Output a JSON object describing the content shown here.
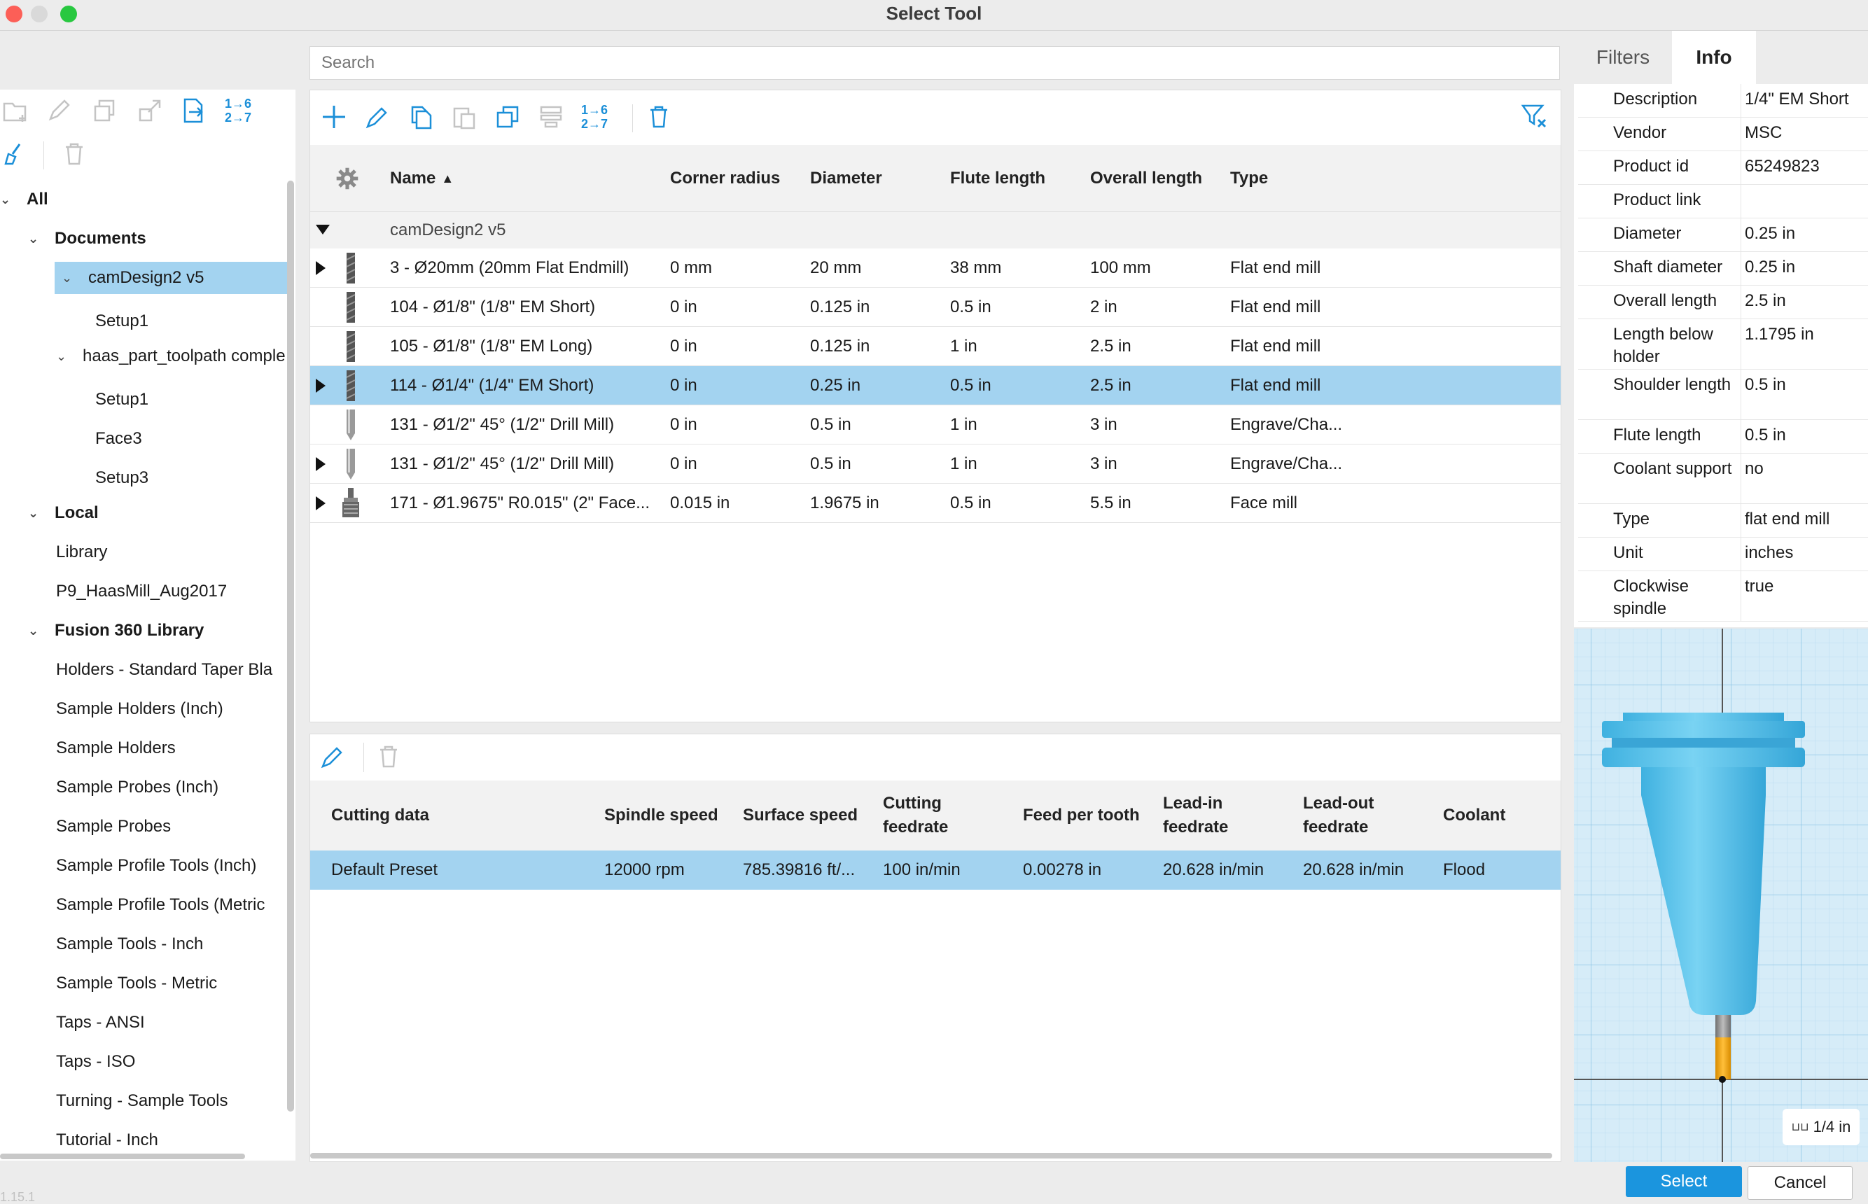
{
  "window": {
    "title": "Select Tool"
  },
  "search": {
    "placeholder": "Search"
  },
  "sidebar": {
    "toolbar_number_label": "1→6\n2→7",
    "tree": [
      {
        "label": "All",
        "level": 0,
        "expanded": true,
        "bold": true
      },
      {
        "label": "Documents",
        "level": 1,
        "expanded": true,
        "bold": true
      },
      {
        "label": "camDesign2 v5",
        "level": 2,
        "expanded": true,
        "selected": true
      },
      {
        "label": "Setup1",
        "level": 3
      },
      {
        "label": "haas_part_toolpath comple",
        "level": 2,
        "expanded": true
      },
      {
        "label": "Setup1",
        "level": 3
      },
      {
        "label": "Face3",
        "level": 3
      },
      {
        "label": "Setup3",
        "level": 3
      },
      {
        "label": "Local",
        "level": 1,
        "expanded": true,
        "bold": true
      },
      {
        "label": "Library",
        "level": 2
      },
      {
        "label": "P9_HaasMill_Aug2017",
        "level": 2
      },
      {
        "label": "Fusion 360 Library",
        "level": 1,
        "expanded": true,
        "bold": true
      },
      {
        "label": "Holders - Standard Taper Bla",
        "level": 2
      },
      {
        "label": "Sample Holders (Inch)",
        "level": 2
      },
      {
        "label": "Sample Holders",
        "level": 2
      },
      {
        "label": "Sample Probes (Inch)",
        "level": 2
      },
      {
        "label": "Sample Probes",
        "level": 2
      },
      {
        "label": "Sample Profile Tools (Inch)",
        "level": 2
      },
      {
        "label": "Sample Profile Tools (Metric",
        "level": 2
      },
      {
        "label": "Sample Tools - Inch",
        "level": 2
      },
      {
        "label": "Sample Tools - Metric",
        "level": 2
      },
      {
        "label": "Taps - ANSI",
        "level": 2
      },
      {
        "label": "Taps - ISO",
        "level": 2
      },
      {
        "label": "Turning - Sample Tools",
        "level": 2
      },
      {
        "label": "Tutorial - Inch",
        "level": 2
      }
    ]
  },
  "tools": {
    "columns": [
      "Name",
      "Corner radius",
      "Diameter",
      "Flute length",
      "Overall length",
      "Type"
    ],
    "group": "camDesign2 v5",
    "rows": [
      {
        "name": "3 - Ø20mm (20mm Flat Endmill)",
        "corner": "0 mm",
        "diameter": "20 mm",
        "flute": "38 mm",
        "overall": "100 mm",
        "type": "Flat end mill",
        "expandable": true,
        "icon": "flat-endmill-icon"
      },
      {
        "name": "104 - Ø1/8\" (1/8\" EM Short)",
        "corner": "0 in",
        "diameter": "0.125 in",
        "flute": "0.5 in",
        "overall": "2 in",
        "type": "Flat end mill",
        "expandable": false,
        "icon": "flat-endmill-icon"
      },
      {
        "name": "105 - Ø1/8\" (1/8\" EM Long)",
        "corner": "0 in",
        "diameter": "0.125 in",
        "flute": "1 in",
        "overall": "2.5 in",
        "type": "Flat end mill",
        "expandable": false,
        "icon": "flat-endmill-icon"
      },
      {
        "name": "114 - Ø1/4\" (1/4\" EM Short)",
        "corner": "0 in",
        "diameter": "0.25 in",
        "flute": "0.5 in",
        "overall": "2.5 in",
        "type": "Flat end mill",
        "expandable": true,
        "selected": true,
        "icon": "flat-endmill-icon"
      },
      {
        "name": "131 - Ø1/2\" 45° (1/2\" Drill Mill)",
        "corner": "0 in",
        "diameter": "0.5 in",
        "flute": "1 in",
        "overall": "3 in",
        "type": "Engrave/Cha...",
        "expandable": false,
        "icon": "drill-mill-icon"
      },
      {
        "name": "131 - Ø1/2\" 45° (1/2\" Drill Mill)",
        "corner": "0 in",
        "diameter": "0.5 in",
        "flute": "1 in",
        "overall": "3 in",
        "type": "Engrave/Cha...",
        "expandable": true,
        "icon": "drill-mill-icon"
      },
      {
        "name": "171 - Ø1.9675\" R0.015\" (2\" Face...",
        "corner": "0.015 in",
        "diameter": "1.9675 in",
        "flute": "0.5 in",
        "overall": "5.5 in",
        "type": "Face mill",
        "expandable": true,
        "icon": "face-mill-icon"
      }
    ]
  },
  "cutting": {
    "columns": [
      "Cutting data",
      "Spindle speed",
      "Surface speed",
      "Cutting\nfeedrate",
      "Feed per tooth",
      "Lead-in\nfeedrate",
      "Lead-out\nfeedrate",
      "Coolant"
    ],
    "rows": [
      [
        "Default Preset",
        "12000 rpm",
        "785.39816 ft/...",
        "100 in/min",
        "0.00278 in",
        "20.628 in/min",
        "20.628 in/min",
        "Flood"
      ]
    ]
  },
  "info_panel": {
    "tabs": [
      "Filters",
      "Info"
    ],
    "active_tab": "Info",
    "rows": [
      {
        "key": "Description",
        "value": "1/4\" EM Short"
      },
      {
        "key": "Vendor",
        "value": "MSC"
      },
      {
        "key": "Product id",
        "value": "65249823"
      },
      {
        "key": "Product link",
        "value": ""
      },
      {
        "key": "Diameter",
        "value": "0.25 in"
      },
      {
        "key": "Shaft diameter",
        "value": "0.25 in"
      },
      {
        "key": "Overall length",
        "value": "2.5 in"
      },
      {
        "key": "Length below holder",
        "value": "1.1795 in"
      },
      {
        "key": "Shoulder length",
        "value": "0.5 in"
      },
      {
        "key": "Flute length",
        "value": "0.5 in"
      },
      {
        "key": "Coolant support",
        "value": "no"
      },
      {
        "key": "Type",
        "value": "flat end mill"
      },
      {
        "key": "Unit",
        "value": "inches"
      },
      {
        "key": "Clockwise spindle",
        "value": "true"
      }
    ],
    "scale_label": "1/4 in"
  },
  "buttons": {
    "select": "Select",
    "cancel": "Cancel"
  },
  "footer": {
    "version": "1.15.1"
  },
  "colors": {
    "accent": "#1b95de",
    "selection": "#a3d3f0",
    "tool_body": "#5bc3ea",
    "flute": "#f0a500"
  }
}
